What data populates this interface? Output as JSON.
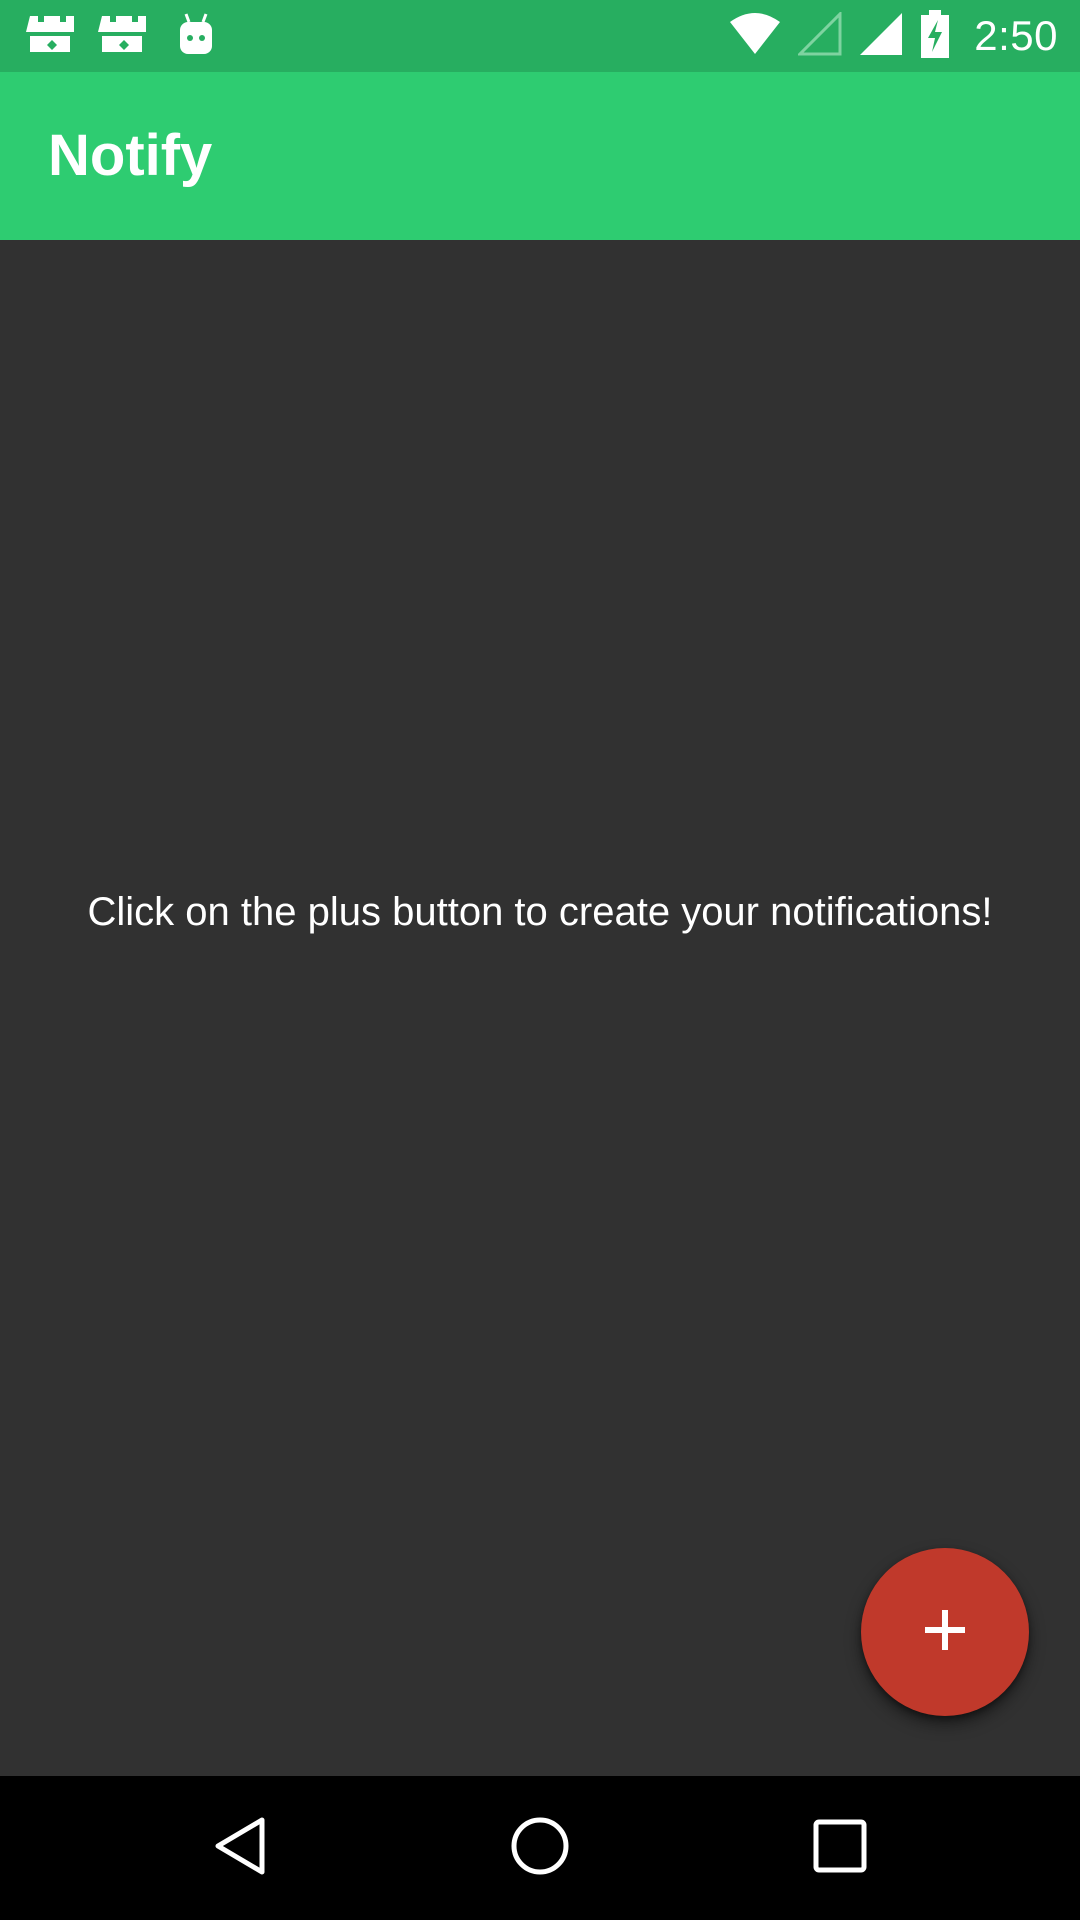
{
  "status_bar": {
    "time": "2:50",
    "notification_icons": [
      "castle-notification-icon",
      "castle-notification-icon",
      "android-robot-icon"
    ],
    "system_icons": [
      "wifi-icon",
      "signal-empty-icon",
      "signal-full-icon",
      "battery-charging-icon"
    ]
  },
  "app_bar": {
    "title": "Notify"
  },
  "main": {
    "empty_message": "Click on the plus button to create your notifications!"
  },
  "fab": {
    "icon": "plus-icon"
  },
  "nav_bar": {
    "buttons": [
      "back-icon",
      "home-icon",
      "recents-icon"
    ]
  },
  "colors": {
    "status_bar": "#27ae60",
    "app_bar": "#2ecc71",
    "background": "#313131",
    "fab": "#c0392b",
    "nav_bar": "#000000"
  }
}
